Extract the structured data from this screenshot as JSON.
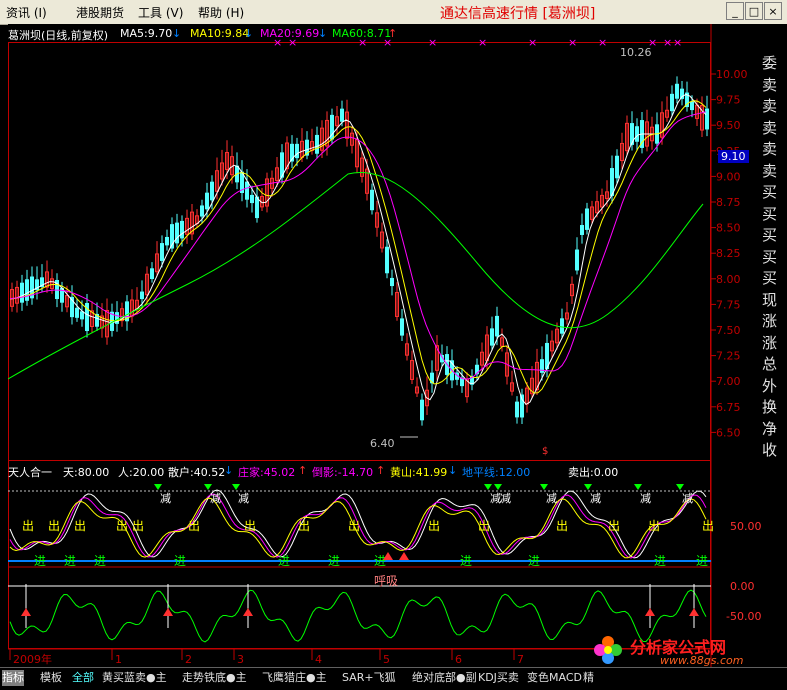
{
  "menu": {
    "items": [
      "资讯 (I)",
      "港股期货",
      "工具 (V)",
      "帮助 (H)"
    ],
    "app_title": "通达信高速行情 [葛洲坝]"
  },
  "window_buttons": {
    "minimize": "_",
    "maximize": "□",
    "close": "×"
  },
  "main_chart": {
    "title": "葛洲坝(日线,前复权)",
    "ma": [
      {
        "label": "MA5:9.70",
        "arrow": "↓",
        "color": "#ffffff"
      },
      {
        "label": "MA10:9.84",
        "arrow": "↓",
        "color": "#ffff00"
      },
      {
        "label": "MA20:9.69",
        "arrow": "↓",
        "color": "#ff00ff"
      },
      {
        "label": "MA60:8.71",
        "arrow": "↑",
        "color": "#00ff00"
      }
    ],
    "high_label": "10.26",
    "low_label": "6.40",
    "current_price": "9.10",
    "y_ticks": [
      "10.00",
      "9.75",
      "9.50",
      "9.25",
      "9.00",
      "8.75",
      "8.50",
      "8.25",
      "8.00",
      "7.75",
      "7.50",
      "7.25",
      "7.00",
      "6.75",
      "6.50"
    ]
  },
  "indicator": {
    "name": "天人合一",
    "items": [
      {
        "label": "天:80.00",
        "color": "#ffffff"
      },
      {
        "label": "人:20.00",
        "color": "#ffffff"
      },
      {
        "label": "散户:40.52",
        "color": "#ffffff",
        "arrow": "↓"
      },
      {
        "label": "庄家:45.02",
        "color": "#ff00ff",
        "arrow": "↑"
      },
      {
        "label": "倒影:-14.70",
        "color": "#ff00ff",
        "arrow": "↑"
      },
      {
        "label": "黄山:41.99",
        "color": "#ffff00",
        "arrow": "↓"
      },
      {
        "label": "地平线:12.00",
        "color": "#0080ff"
      },
      {
        "label": "卖出:0.00",
        "color": "#ffffff"
      }
    ],
    "signal_labels": {
      "reduce": "减",
      "out": "出",
      "in": "进",
      "breath": "呼吸"
    },
    "y_ticks": [
      "50.00",
      "0.00",
      "-50.00"
    ]
  },
  "date_axis": [
    "2009年",
    "1",
    "2",
    "3",
    "4",
    "5",
    "6",
    "7"
  ],
  "right_panel": [
    "委",
    "卖",
    "卖",
    "卖",
    "卖",
    "卖",
    "买",
    "买",
    "买",
    "买",
    "买",
    "现",
    "涨",
    "涨",
    "总",
    "外",
    "换",
    "净",
    "收"
  ],
  "bottom_tabs": [
    "指标",
    "模板",
    "全部",
    "黄买蓝卖●主",
    "走势铁底●主",
    "飞鹰猎庄●主",
    "SAR+飞狐",
    "绝对底部●副",
    "KDJ买卖",
    "变色MACD",
    "精"
  ],
  "logo": {
    "text": "分析家公式网",
    "url_text": "www.88gs.com"
  },
  "colors": {
    "up": "#ff3030",
    "down": "#54ffff",
    "ma5": "#ffffff",
    "ma10": "#ffff00",
    "ma20": "#ff00ff",
    "ma60": "#00ff00",
    "axis": "#c00000"
  }
}
